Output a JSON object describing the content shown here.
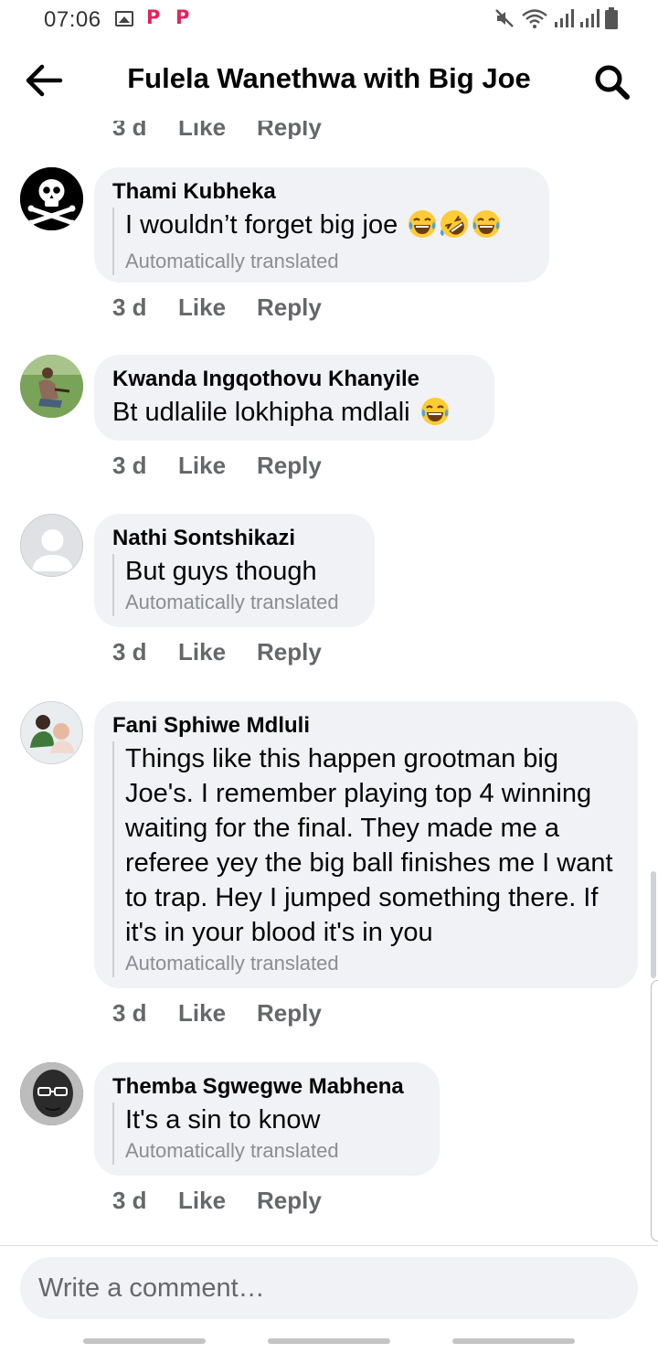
{
  "status_bar": {
    "time": "07:06",
    "icons": [
      "image-icon",
      "p-app-icon",
      "p-app-icon",
      "mute-icon",
      "wifi-icon",
      "signal-icon",
      "signal-icon",
      "battery-icon"
    ],
    "p_glyph": "P"
  },
  "header": {
    "title": "Fulela Wanethwa with Big Joe",
    "back_icon": "back-arrow-icon",
    "search_icon": "search-icon"
  },
  "previous_meta": {
    "time": "3 d",
    "like": "Like",
    "reply": "Reply"
  },
  "comments": [
    {
      "author": "Thami Kubheka",
      "body": "I wouldn’t forget big joe",
      "emojis": [
        "face-with-tears-of-joy-icon",
        "rolling-on-floor-laughing-icon",
        "face-with-tears-of-joy-icon"
      ],
      "translated": "Automatically translated",
      "time": "3 d",
      "like": "Like",
      "reply": "Reply"
    },
    {
      "author": "Kwanda Ingqothovu Khanyile",
      "body": "Bt udlalile lokhipha mdlali",
      "emojis": [
        "face-with-tears-of-joy-icon"
      ],
      "time": "3 d",
      "like": "Like",
      "reply": "Reply"
    },
    {
      "author": "Nathi Sontshikazi",
      "body": "But guys though",
      "translated": "Automatically translated",
      "time": "3 d",
      "like": "Like",
      "reply": "Reply"
    },
    {
      "author": "Fani Sphiwe Mdluli",
      "body": "Things like this happen grootman big Joe's. I remember playing top 4 winning waiting for the final. They made me a referee yey the big ball finishes me I want to trap. Hey I jumped something there. If it's in your blood it's in you",
      "translated": "Automatically translated",
      "time": "3 d",
      "like": "Like",
      "reply": "Reply"
    },
    {
      "author": "Themba Sgwegwe Mabhena",
      "body": "It's a sin to know",
      "translated": "Automatically translated",
      "time": "3 d",
      "like": "Like",
      "reply": "Reply"
    }
  ],
  "composer": {
    "placeholder": "Write a comment…"
  },
  "colors": {
    "bubble": "#f0f2f5",
    "meta_text": "#65676b",
    "translated_text": "#8a8d91",
    "accent_p": "#e0245e"
  }
}
